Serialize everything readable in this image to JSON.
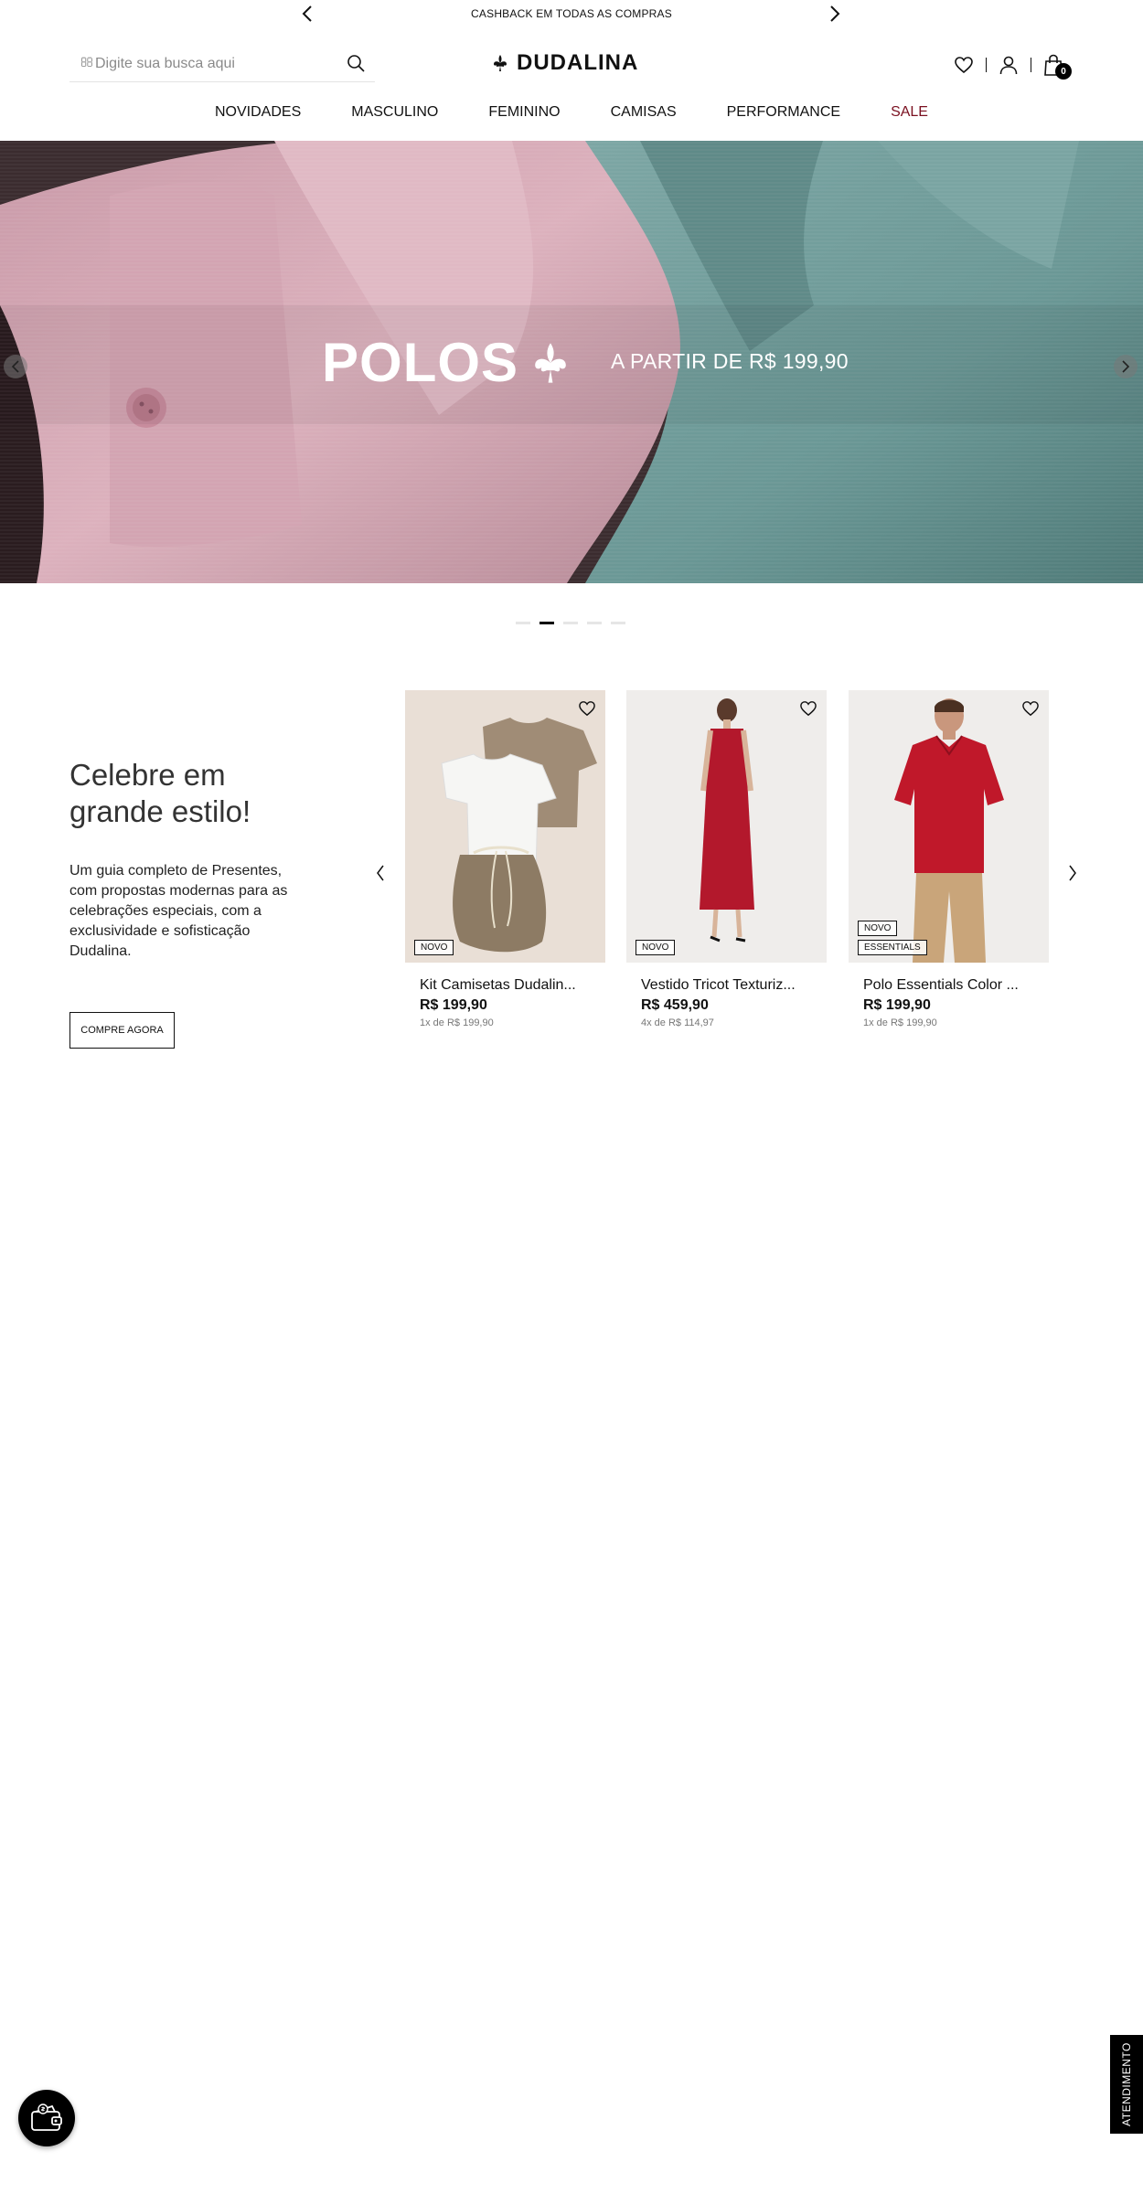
{
  "announcement": {
    "text": "CASHBACK EM TODAS AS COMPRAS"
  },
  "search": {
    "placeholder": "Digite sua busca aqui",
    "lead_glyph": ""
  },
  "brand": {
    "name": "DUDALINA"
  },
  "header": {
    "cart_count": "0"
  },
  "nav": {
    "items": [
      {
        "label": "NOVIDADES"
      },
      {
        "label": "MASCULINO"
      },
      {
        "label": "FEMININO"
      },
      {
        "label": "CAMISAS"
      },
      {
        "label": "PERFORMANCE"
      },
      {
        "label": "SALE",
        "color": "#7a1020"
      }
    ]
  },
  "hero": {
    "headline": "POLOS",
    "subtitle": "A PARTIR DE R$ 199,90",
    "slides": 5,
    "active_slide": 2
  },
  "promo": {
    "title": "Celebre em grande estilo!",
    "text": "Um guia completo de Presentes, com propostas modernas para as celebrações especiais, com a exclusividade e sofisticação Dudalina.",
    "cta": "COMPRE AGORA"
  },
  "products": [
    {
      "name": "Kit Camisetas Dudalin...",
      "price": "R$ 199,90",
      "installments": "1x de R$ 199,90",
      "badges": [
        "NOVO"
      ]
    },
    {
      "name": "Vestido Tricot Texturiz...",
      "price": "R$ 459,90",
      "installments": "4x de R$ 114,97",
      "badges": [
        "NOVO"
      ]
    },
    {
      "name": "Polo Essentials Color ...",
      "price": "R$ 199,90",
      "installments": "1x de R$ 199,90",
      "badges": [
        "NOVO",
        "ESSENTIALS"
      ]
    }
  ],
  "support": {
    "label": "ATENDIMENTO"
  },
  "colors": {
    "sale": "#7a1020",
    "hero_pink": "#d7aab8",
    "hero_teal": "#6f9c9a"
  }
}
